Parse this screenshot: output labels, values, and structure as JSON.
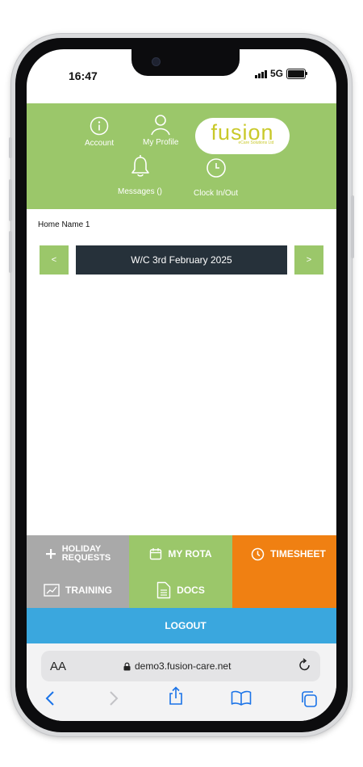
{
  "status_bar": {
    "time": "16:47",
    "network": "5G"
  },
  "header": {
    "account_label": "Account",
    "profile_label": "My Profile",
    "messages_label": "Messages ()",
    "clock_label": "Clock In/Out",
    "logo_text": "fusion",
    "logo_subtext": "eCare Solutions Ltd",
    "color": "#9bc76a"
  },
  "home_name": "Home Name 1",
  "week": {
    "prev_label": "<",
    "next_label": ">",
    "label": "W/C 3rd February 2025"
  },
  "menu": {
    "holiday_label_1": "HOLIDAY",
    "holiday_label_2": "REQUESTS",
    "rota_label": "MY ROTA",
    "timesheet_label": "TIMESHEET",
    "training_label": "TRAINING",
    "docs_label": "DOCS",
    "logout_label": "LOGOUT",
    "colors": {
      "grey": "#a9a9a9",
      "green": "#9bc76a",
      "orange": "#f08012",
      "blue": "#3aa7de"
    }
  },
  "browser": {
    "text_size_label": "AA",
    "url": "demo3.fusion-care.net"
  },
  "icons": [
    "info-icon",
    "person-icon",
    "bell-icon",
    "clock-icon",
    "plus-icon",
    "calendar-icon",
    "chart-icon",
    "document-icon",
    "lock-icon",
    "reload-icon",
    "back-icon",
    "forward-icon",
    "share-icon",
    "bookmarks-icon",
    "tabs-icon"
  ]
}
